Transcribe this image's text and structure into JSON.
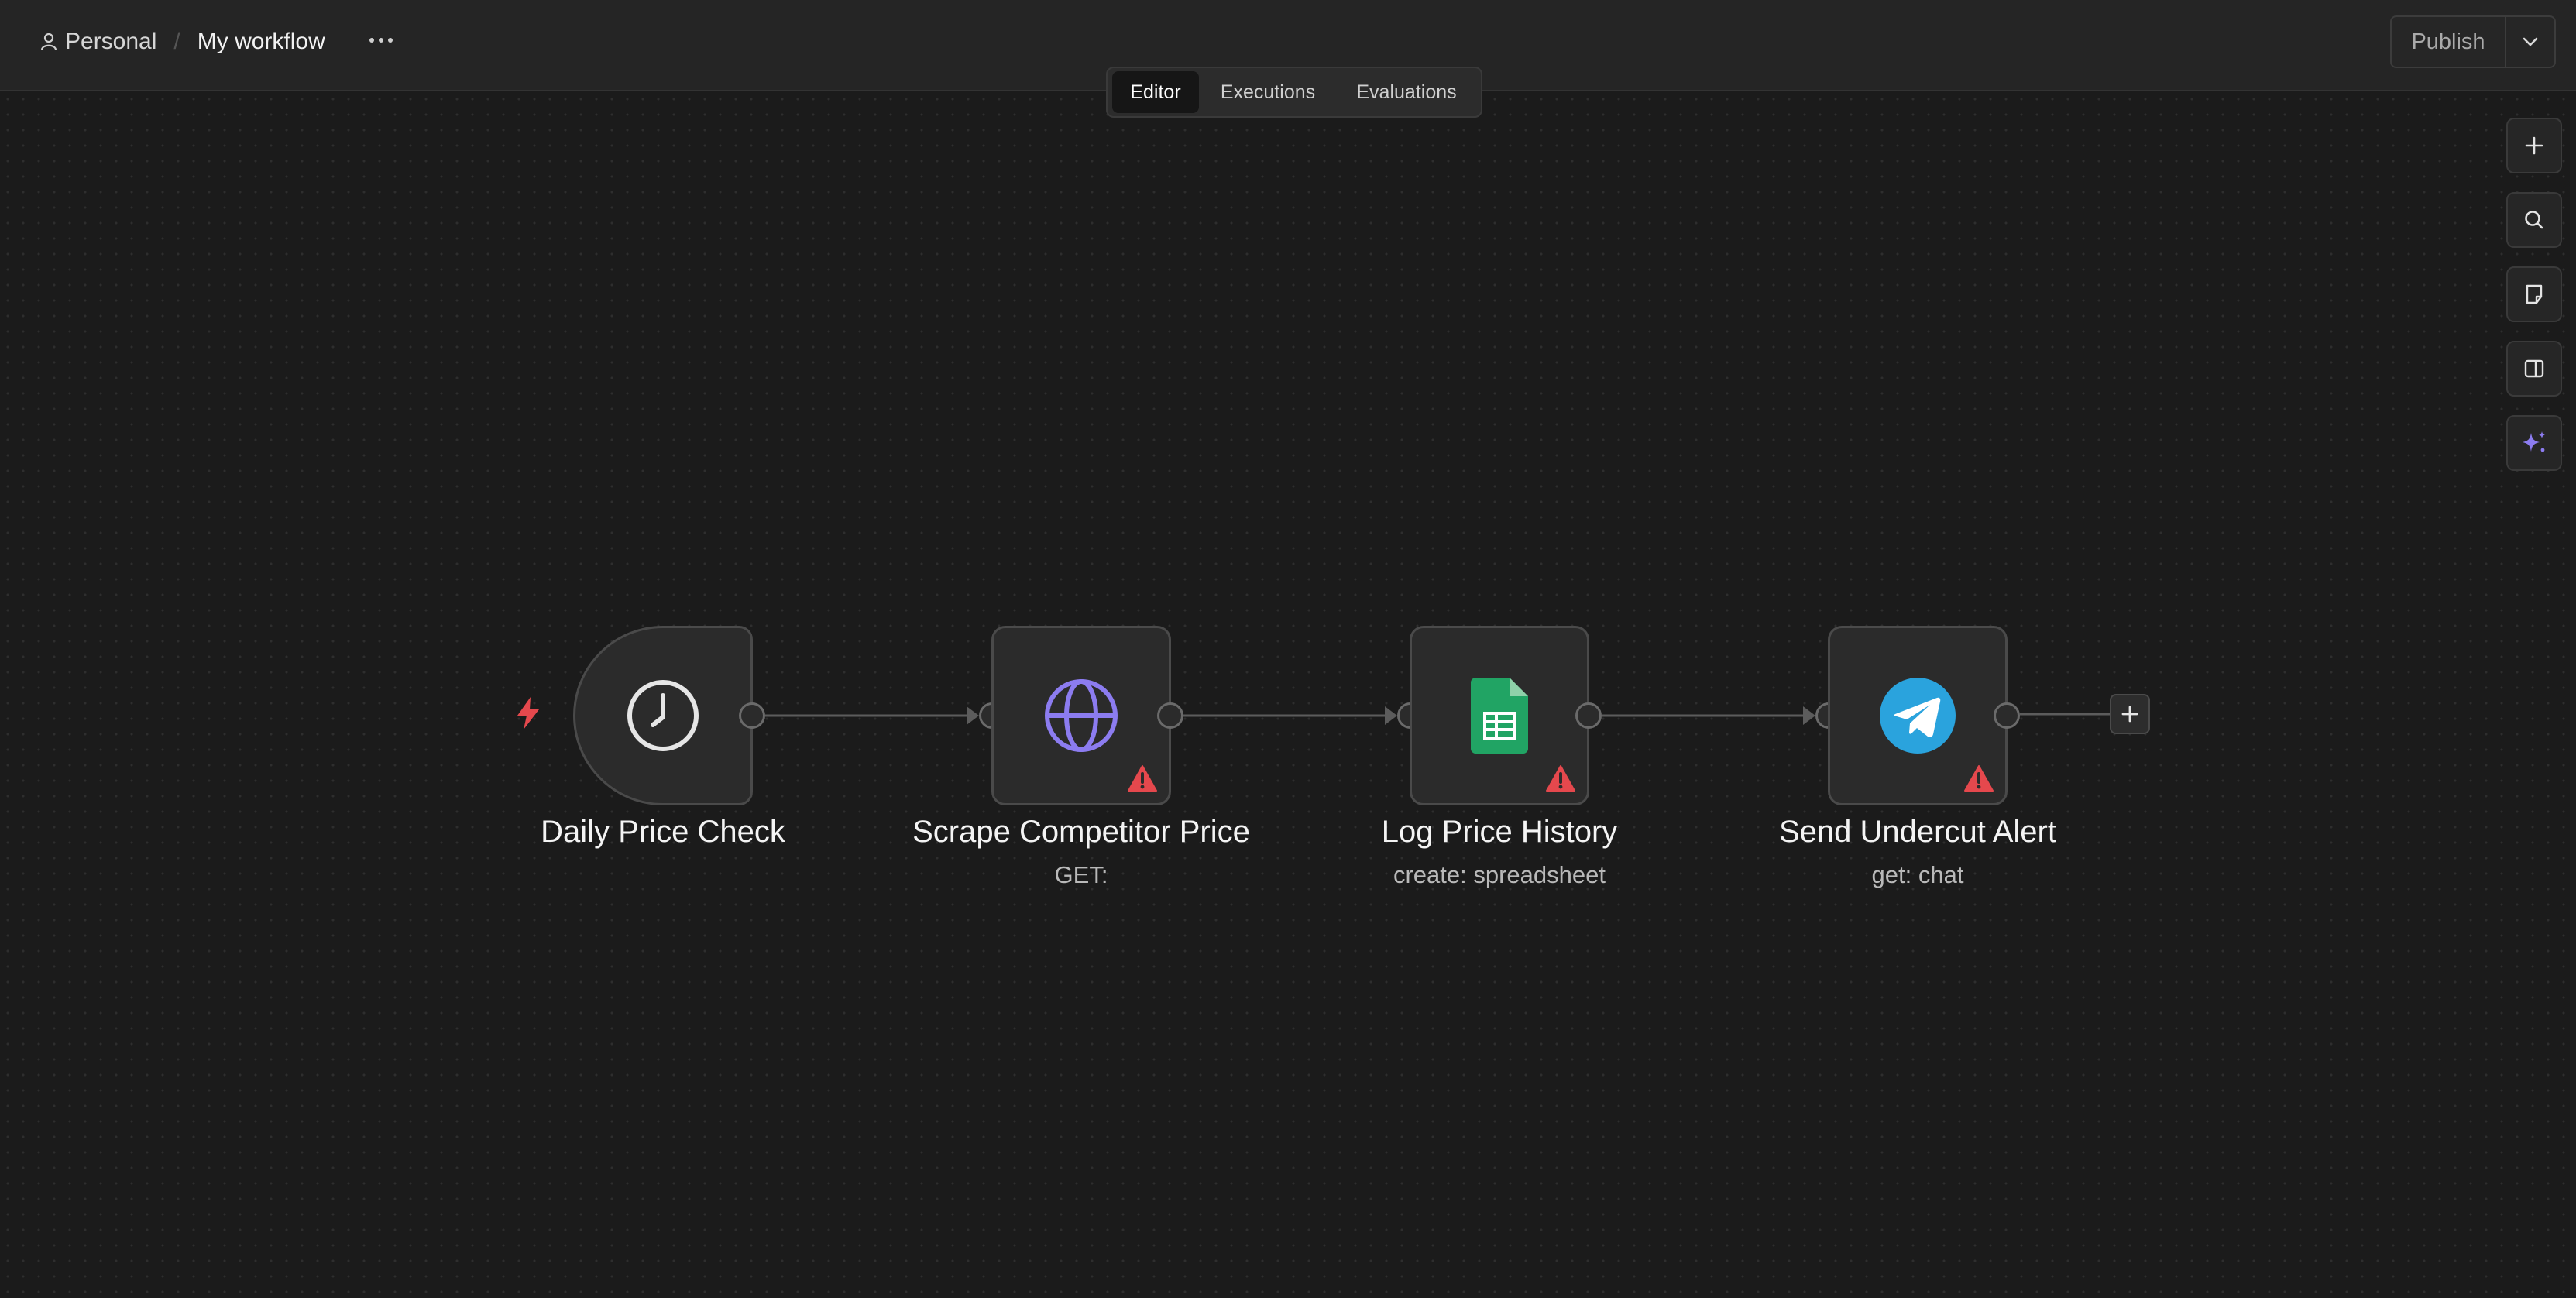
{
  "header": {
    "breadcrumb": {
      "project": "Personal",
      "separator": "/",
      "workflow_name": "My workflow"
    },
    "tabs": [
      {
        "label": "Editor",
        "active": true
      },
      {
        "label": "Executions",
        "active": false
      },
      {
        "label": "Evaluations",
        "active": false
      }
    ],
    "publish_label": "Publish"
  },
  "nodes": [
    {
      "title": "Daily Price Check",
      "subtitle": "",
      "icon": "clock-icon",
      "trigger": true,
      "warning": false
    },
    {
      "title": "Scrape Competitor Price",
      "subtitle": "GET:",
      "icon": "globe-icon",
      "trigger": false,
      "warning": true
    },
    {
      "title": "Log Price History",
      "subtitle": "create: spreadsheet",
      "icon": "google-sheets-icon",
      "trigger": false,
      "warning": true
    },
    {
      "title": "Send Undercut Alert",
      "subtitle": "get: chat",
      "icon": "telegram-icon",
      "trigger": false,
      "warning": true
    }
  ],
  "colors": {
    "background": "#1b1b1b",
    "node": "#2b2b2b",
    "warning": "#e5484d",
    "accent_purple": "#8c7cf0",
    "sheets_green": "#21a464",
    "telegram_blue": "#2aa3dd"
  }
}
